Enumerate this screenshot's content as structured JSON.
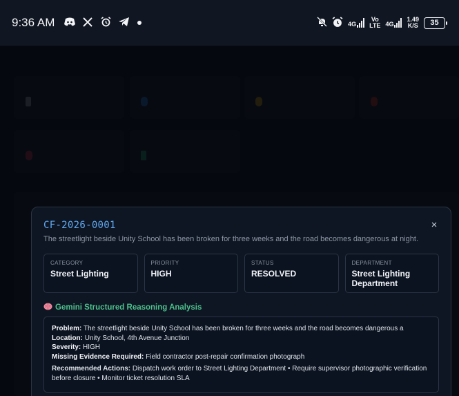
{
  "status_bar": {
    "time": "9:36 AM",
    "left_icons": [
      "discord-icon",
      "x-icon",
      "alarm-icon",
      "telegram-icon"
    ],
    "network_1": "4G",
    "volte": [
      "Vo",
      "LTE"
    ],
    "network_2": "4G",
    "speed_value": "1.49",
    "speed_unit": "K/S",
    "battery": "35"
  },
  "modal": {
    "ticket_id": "CF-2026-0001",
    "description": "The streetlight beside Unity School has been broken for three weeks and the road becomes dangerous at night.",
    "close_glyph": "×",
    "info": [
      {
        "label": "CATEGORY",
        "value": "Street Lighting"
      },
      {
        "label": "PRIORITY",
        "value": "HIGH"
      },
      {
        "label": "STATUS",
        "value": "RESOLVED"
      },
      {
        "label": "DEPARTMENT",
        "value": "Street Lighting Department"
      }
    ],
    "ai_section_title": "Gemini Structured Reasoning Analysis",
    "analysis": {
      "problem_label": "Problem:",
      "problem": "The streetlight beside Unity School has been broken for three weeks and the road becomes dangerous a",
      "location_label": "Location:",
      "location": "Unity School, 4th Avenue Junction",
      "severity_label": "Severity:",
      "severity": "HIGH",
      "missing_label": "Missing Evidence Required:",
      "missing": "Field contractor post-repair confirmation photograph",
      "actions_label": "Recommended Actions:",
      "actions": "Dispatch work order to Street Lighting Department • Require supervisor photographic verification before closure • Monitor ticket resolution SLA"
    }
  },
  "colors": {
    "accent_blue": "#5fa8f0",
    "accent_green": "#4cc08b",
    "modal_bg": "#0f1623"
  }
}
